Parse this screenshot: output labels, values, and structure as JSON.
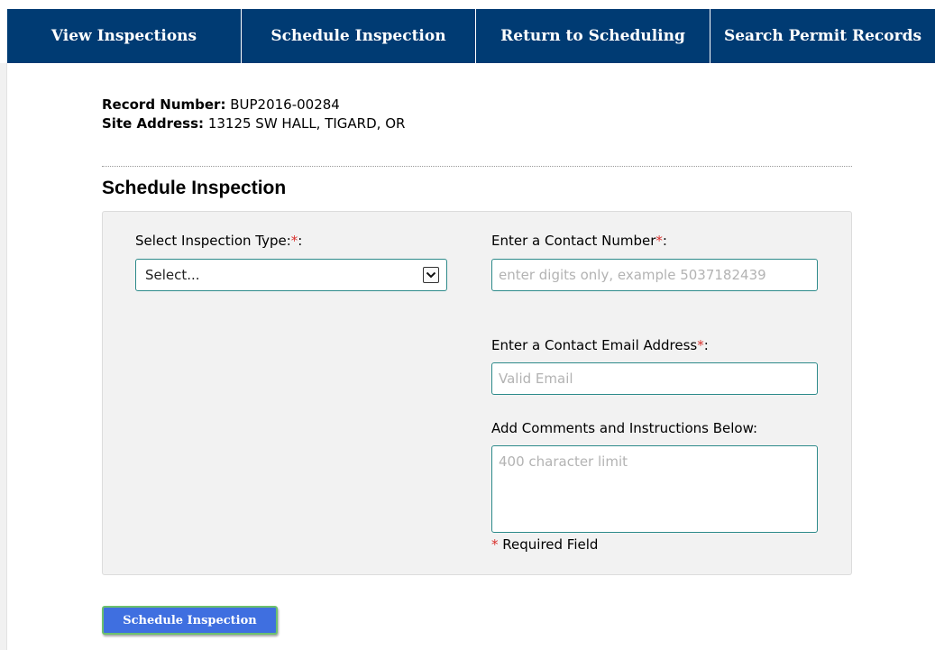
{
  "nav": {
    "items": [
      {
        "label": "View Inspections"
      },
      {
        "label": "Schedule Inspection"
      },
      {
        "label": "Return to Scheduling"
      },
      {
        "label": "Search Permit Records"
      }
    ]
  },
  "record": {
    "number_label": "Record Number:",
    "number_value": "BUP2016-00284",
    "address_label": "Site Address:",
    "address_value": "13125 SW HALL, TIGARD, OR"
  },
  "section": {
    "title": "Schedule Inspection"
  },
  "form": {
    "inspection_type": {
      "label": "Select Inspection Type:",
      "required_mark": "*",
      "suffix": ":",
      "selected": "Select..."
    },
    "contact_number": {
      "label": "Enter a Contact Number",
      "required_mark": "*",
      "suffix": ":",
      "placeholder": "enter digits only, example 5037182439",
      "value": ""
    },
    "contact_email": {
      "label": "Enter a Contact Email Address",
      "required_mark": "*",
      "suffix": ":",
      "placeholder": "Valid Email",
      "value": ""
    },
    "comments": {
      "label": "Add Comments and Instructions Below:",
      "placeholder": "400 character limit",
      "value": ""
    },
    "required_note": {
      "mark": "*",
      "text": " Required Field"
    },
    "submit_label": "Schedule Inspection"
  },
  "colors": {
    "nav_bg": "#003b73",
    "required": "#d9302c",
    "input_border": "#2d8a8a",
    "button_bg": "#3f6fe0",
    "button_border": "#6dc06d"
  },
  "icons": {
    "select_arrow": "chevron-down-icon"
  }
}
